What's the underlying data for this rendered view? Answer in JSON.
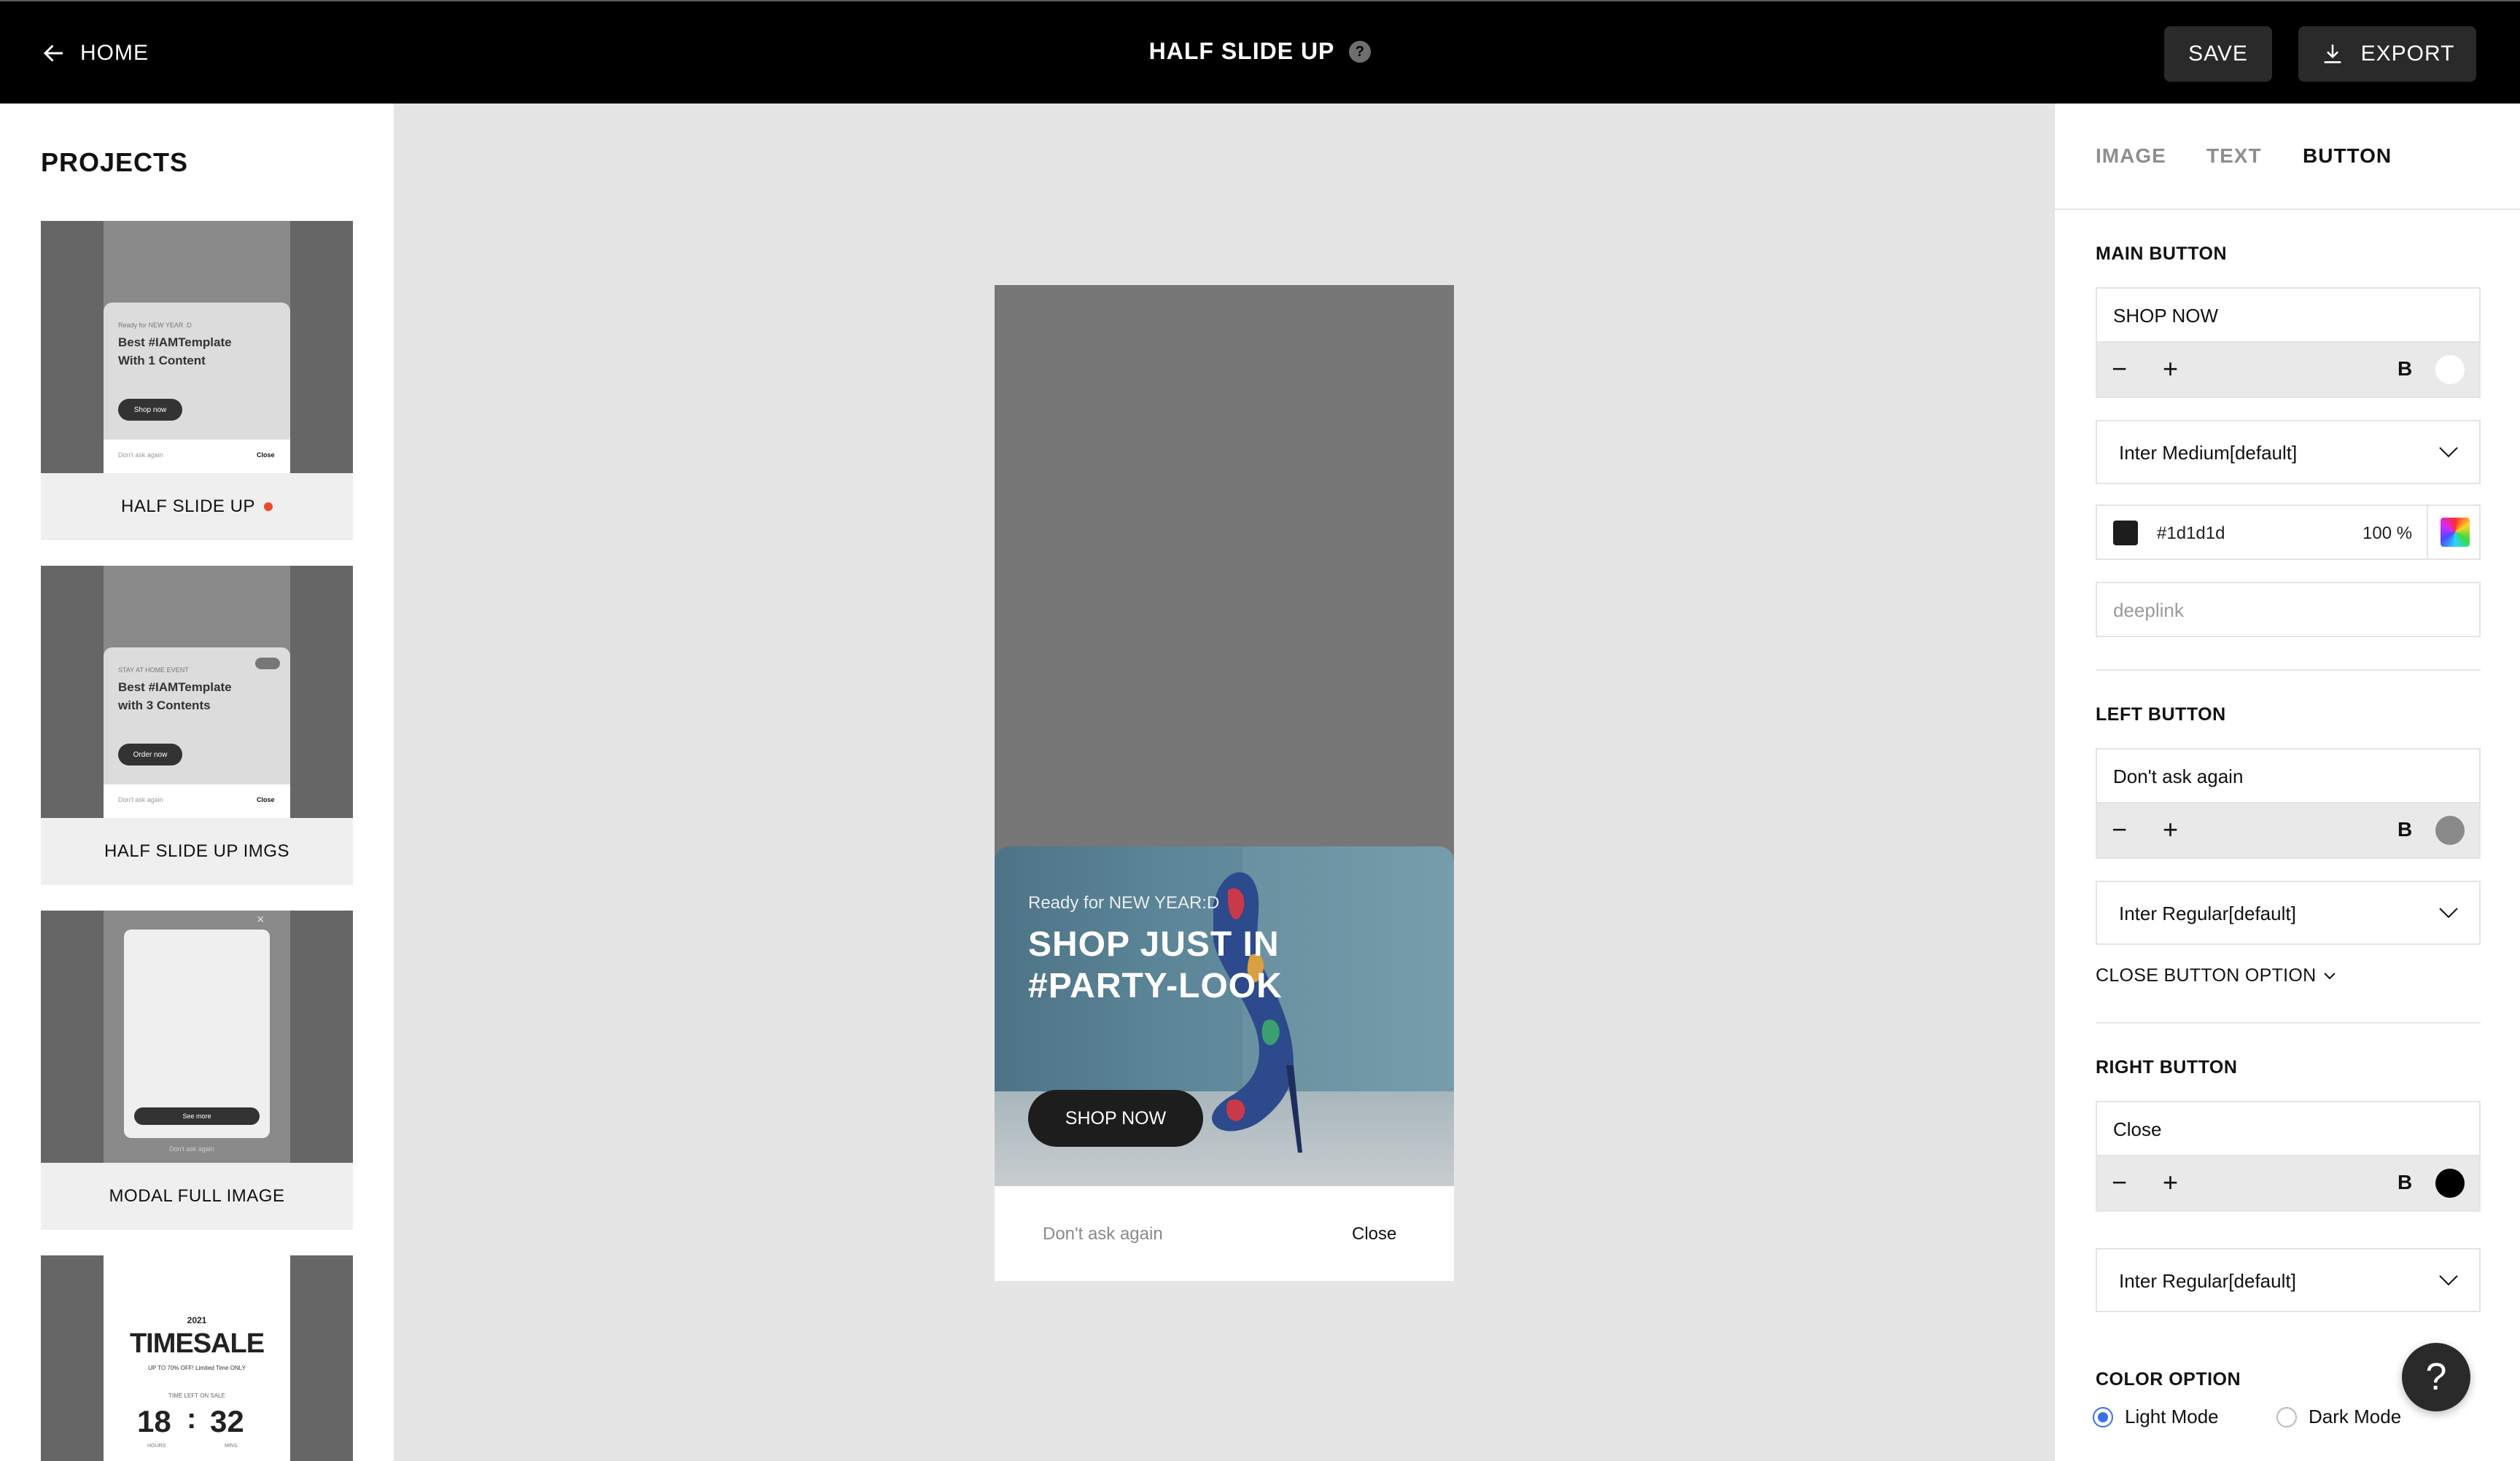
{
  "topbar": {
    "home_label": "HOME",
    "title": "HALF SLIDE UP",
    "help_glyph": "?",
    "save_label": "SAVE",
    "export_label": "EXPORT"
  },
  "sidebar": {
    "title": "PROJECTS",
    "projects": [
      {
        "label": "HALF SLIDE UP",
        "active": true,
        "thumb_kicker": "Ready for NEW YEAR :D",
        "thumb_head_1": "Best #IAMTemplate",
        "thumb_head_2": "With 1 Content",
        "thumb_button": "Shop now",
        "thumb_left": "Don't ask again",
        "thumb_right": "Close"
      },
      {
        "label": "HALF SLIDE UP IMGS",
        "thumb_kicker": "STAY AT HOME EVENT",
        "thumb_head_1": "Best #IAMTemplate",
        "thumb_head_2": "with 3 Contents",
        "thumb_button": "Order now",
        "thumb_left": "Don't ask again",
        "thumb_right": "Close"
      },
      {
        "label": "MODAL FULL IMAGE",
        "thumb_button": "See more",
        "thumb_foot": "Don't ask again",
        "thumb_close": "×"
      },
      {
        "thumb_year": "2021",
        "thumb_title": "TIMESALE",
        "thumb_sub": "UP TO 70% OFF! Limited Time ONLY",
        "thumb_time_label": "TIME LEFT ON SALE",
        "thumb_hours": "18",
        "thumb_colon": ":",
        "thumb_mins": "32",
        "thumb_hours_label": "HOURS",
        "thumb_mins_label": "MINS"
      }
    ]
  },
  "preview": {
    "kicker": "Ready for NEW YEAR:D",
    "headline_1": "SHOP JUST IN",
    "headline_2": "#PARTY-LOOK",
    "cta": "SHOP NOW",
    "left_button": "Don't ask again",
    "right_button": "Close"
  },
  "panel": {
    "tabs": [
      "IMAGE",
      "TEXT",
      "BUTTON"
    ],
    "active_tab": "BUTTON",
    "main_button": {
      "title": "MAIN BUTTON",
      "text": "SHOP NOW",
      "bold_label": "B",
      "text_color": "#ffffff",
      "font": "Inter Medium[default]",
      "bg_hex": "#1d1d1d",
      "bg_opacity": "100 %",
      "deeplink_placeholder": "deeplink"
    },
    "left_button": {
      "title": "LEFT BUTTON",
      "text": "Don't ask again",
      "bold_label": "B",
      "text_color": "#8a8a8a",
      "font": "Inter Regular[default]",
      "close_option": "CLOSE BUTTON OPTION"
    },
    "right_button": {
      "title": "RIGHT BUTTON",
      "text": "Close",
      "bold_label": "B",
      "text_color": "#000000",
      "font": "Inter Regular[default]"
    },
    "color_option": {
      "title": "COLOR OPTION",
      "light": "Light Mode",
      "dark": "Dark Mode",
      "selected": "Light Mode"
    }
  },
  "help_fab": "?",
  "icons": {
    "home": "arrow-left-icon",
    "export": "download-icon",
    "select": "chevron-down-icon",
    "picker": "color-picker-icon"
  }
}
